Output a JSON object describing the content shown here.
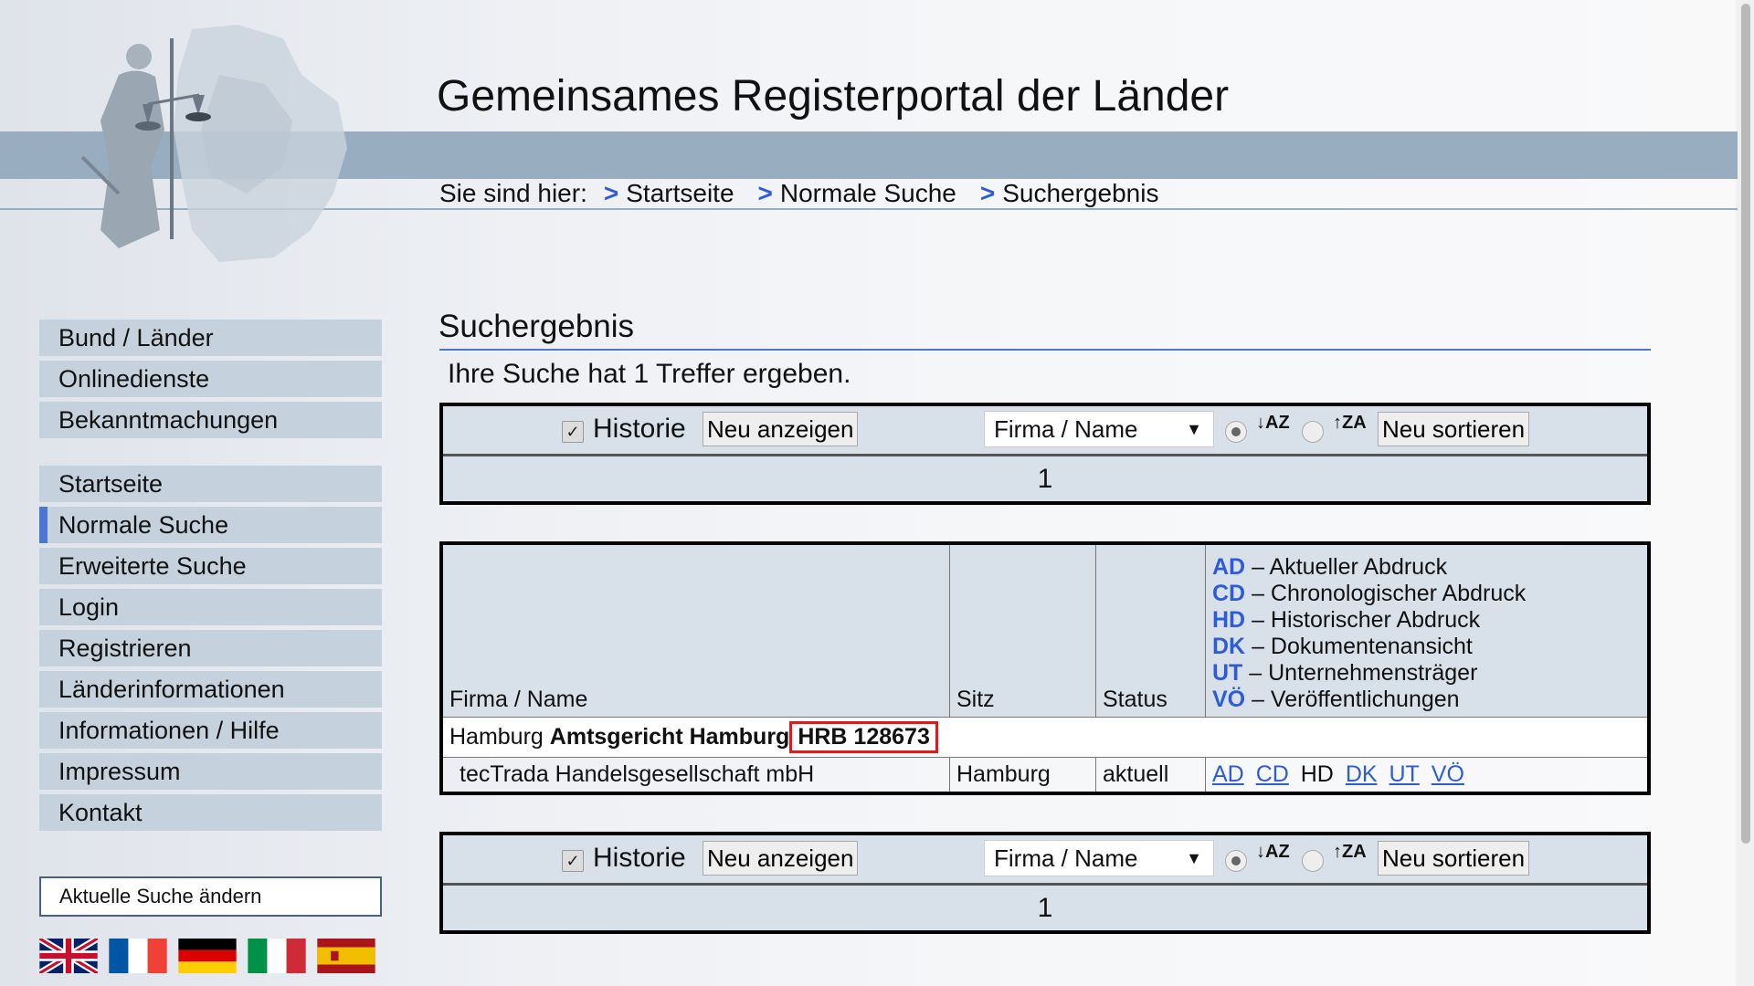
{
  "header": {
    "title": "Gemeinsames Registerportal der Länder",
    "breadcrumb_label": "Sie sind hier:",
    "breadcrumb": [
      {
        "arrow": ">",
        "label": "Startseite"
      },
      {
        "arrow": ">",
        "label": "Normale Suche"
      },
      {
        "arrow": ">",
        "label": "Suchergebnis"
      }
    ]
  },
  "sidebar": {
    "group1": [
      "Bund / Länder",
      "Onlinedienste",
      "Bekanntmachungen"
    ],
    "group2": [
      "Startseite",
      "Normale Suche",
      "Erweiterte Suche",
      "Login",
      "Registrieren",
      "Länderinformationen",
      "Informationen / Hilfe",
      "Impressum",
      "Kontakt"
    ],
    "active": "Normale Suche",
    "change_search": "Aktuelle Suche ändern",
    "flags": [
      "uk-flag",
      "france-flag",
      "germany-flag",
      "italy-flag",
      "spain-flag"
    ]
  },
  "main": {
    "heading": "Suchergebnis",
    "result_count": "Ihre Suche hat 1 Treffer ergeben."
  },
  "controls": {
    "historie_label": "Historie",
    "historie_checked": true,
    "show_button": "Neu anzeigen",
    "sort_select": "Firma / Name",
    "sort_asc_checked": true,
    "sort_desc_checked": false,
    "sort_asc_icon": "↓AZ",
    "sort_desc_icon": "↑ZA",
    "resort_button": "Neu sortieren",
    "page": "1"
  },
  "table": {
    "headers": {
      "firma": "Firma / Name",
      "sitz": "Sitz",
      "status": "Status"
    },
    "legend": [
      {
        "key": "AD",
        "text": "– Aktueller Abdruck"
      },
      {
        "key": "CD",
        "text": "– Chronologischer Abdruck"
      },
      {
        "key": "HD",
        "text": "– Historischer Abdruck"
      },
      {
        "key": "DK",
        "text": "– Dokumentenansicht"
      },
      {
        "key": "UT",
        "text": "– Unternehmensträger"
      },
      {
        "key": "VÖ",
        "text": "– Veröffentlichungen"
      }
    ],
    "court_prefix": "Hamburg",
    "court_name": "Amtsgericht Hamburg",
    "register_number": "HRB 128673",
    "row": {
      "firma": "tecTrada Handelsgesellschaft mbH",
      "sitz": "Hamburg",
      "status": "aktuell",
      "doc_links": [
        "AD",
        "CD",
        "HD",
        "DK",
        "UT",
        "VÖ"
      ],
      "doc_plain": "HD"
    }
  },
  "colors": {
    "accent": "#2e5cd9",
    "band": "#98adbf",
    "nav": "#c5d2dd",
    "highlight": "#e01a1a"
  }
}
